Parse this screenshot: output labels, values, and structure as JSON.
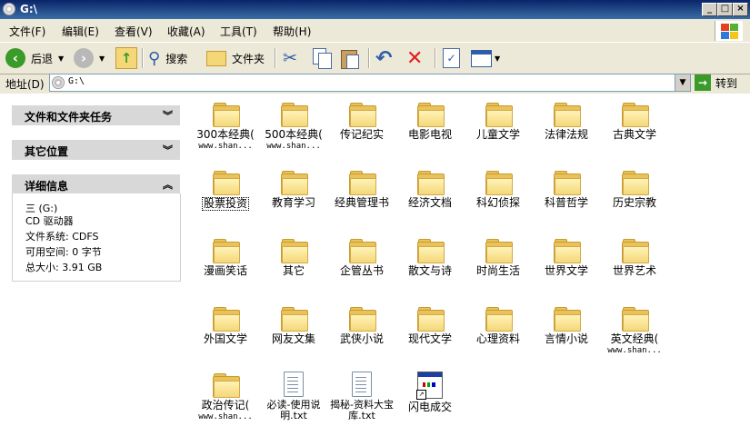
{
  "window": {
    "title": "G:\\",
    "min": "_",
    "max": "□",
    "close": "×"
  },
  "menu": [
    "文件(F)",
    "编辑(E)",
    "查看(V)",
    "收藏(A)",
    "工具(T)",
    "帮助(H)"
  ],
  "toolbar": {
    "back": "后退",
    "search": "搜索",
    "folders": "文件夹"
  },
  "address": {
    "label": "地址(D)",
    "value": "G:\\",
    "go": "转到"
  },
  "left_pane": {
    "tasks_title": "文件和文件夹任务",
    "other_title": "其它位置",
    "details_title": "详细信息",
    "details": {
      "name": "三 (G:)",
      "type": "CD 驱动器",
      "fs": "文件系统: CDFS",
      "free": "可用空间: 0 字节",
      "total": "总大小: 3.91 GB"
    }
  },
  "items": [
    {
      "name": "300本经典(",
      "sub": "www.shan..."
    },
    {
      "name": "500本经典(",
      "sub": "www.shan..."
    },
    {
      "name": "传记纪实"
    },
    {
      "name": "电影电视"
    },
    {
      "name": "儿童文学"
    },
    {
      "name": "法律法规"
    },
    {
      "name": "古典文学"
    },
    {
      "name": "股票投资"
    },
    {
      "name": "教育学习"
    },
    {
      "name": "经典管理书"
    },
    {
      "name": "经济文档"
    },
    {
      "name": "科幻侦探"
    },
    {
      "name": "科普哲学"
    },
    {
      "name": "历史宗教"
    },
    {
      "name": "漫画笑话"
    },
    {
      "name": "其它"
    },
    {
      "name": "企管丛书"
    },
    {
      "name": "散文与诗"
    },
    {
      "name": "时尚生活"
    },
    {
      "name": "世界文学"
    },
    {
      "name": "世界艺术"
    },
    {
      "name": "外国文学"
    },
    {
      "name": "网友文集"
    },
    {
      "name": "武侠小说"
    },
    {
      "name": "现代文学"
    },
    {
      "name": "心理资料"
    },
    {
      "name": "言情小说"
    },
    {
      "name": "英文经典(",
      "sub": "www.shan..."
    },
    {
      "name": "政治传记(",
      "sub": "www.shan..."
    },
    {
      "name": "必读-使用说明.txt"
    },
    {
      "name": "揭秘-资料大宝库.txt"
    },
    {
      "name": "闪电成交"
    }
  ]
}
